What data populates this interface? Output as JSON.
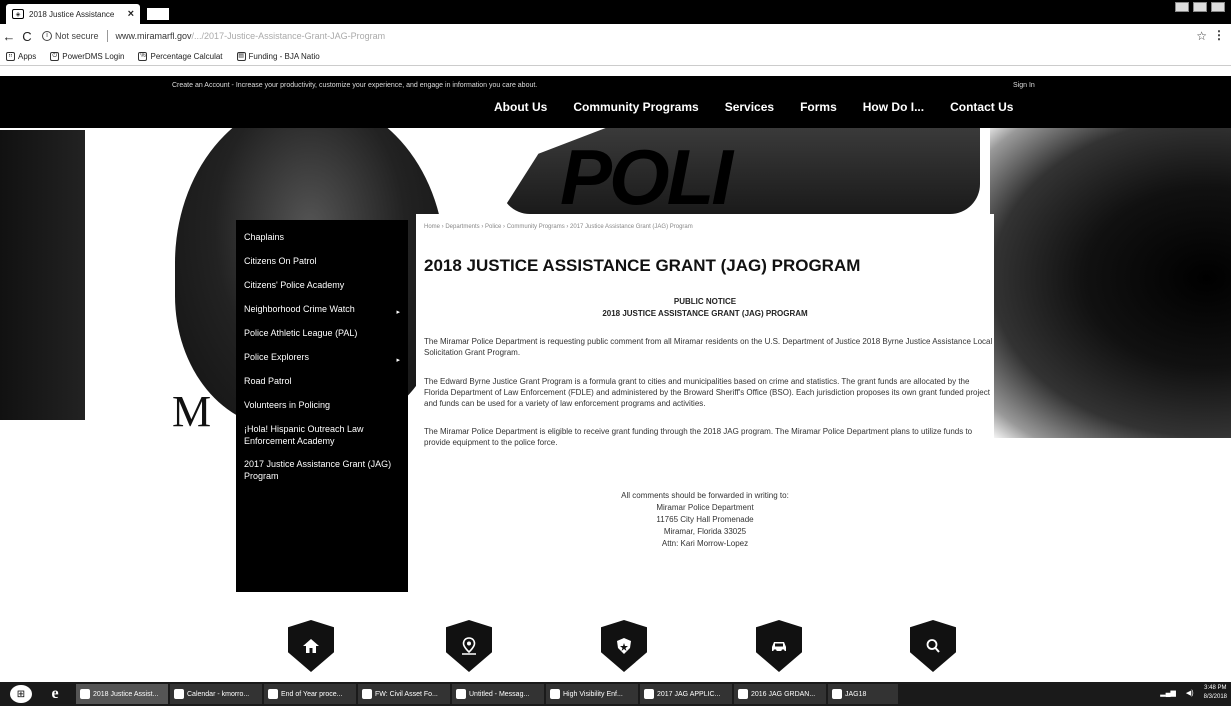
{
  "browser": {
    "tab_title": "2018 Justice Assistance",
    "tab_close": "×",
    "nav_back": "←",
    "nav_reload": "C",
    "security_label": "Not secure",
    "url": "www.miramarfl.gov",
    "url_path": "/.../2017-Justice-Assistance-Grant-JAG-Program",
    "star": "☆",
    "menu": "⋮",
    "bookmarks": [
      {
        "label": "Apps"
      },
      {
        "label": "PowerDMS Login"
      },
      {
        "label": "Percentage Calculat"
      },
      {
        "label": "Funding - BJA Natio"
      }
    ]
  },
  "site_header": {
    "promo": "Create an Account - Increase your productivity, customize your experience, and engage in information you care about.",
    "signin": "Sign In",
    "nav": [
      {
        "label": "About Us"
      },
      {
        "label": "Community Programs"
      },
      {
        "label": "Services"
      },
      {
        "label": "Forms"
      },
      {
        "label": "How Do I..."
      },
      {
        "label": "Contact Us"
      }
    ]
  },
  "hero": {
    "badge_letter": "M",
    "car_letters": "POLI"
  },
  "sidebar": {
    "items": [
      {
        "label": "Chaplains",
        "arrow": ""
      },
      {
        "label": "Citizens On Patrol",
        "arrow": ""
      },
      {
        "label": "Citizens' Police Academy",
        "arrow": ""
      },
      {
        "label": "Neighborhood Crime Watch",
        "arrow": "▸"
      },
      {
        "label": "Police Athletic League (PAL)",
        "arrow": ""
      },
      {
        "label": "Police Explorers",
        "arrow": "▸"
      },
      {
        "label": "Road Patrol",
        "arrow": ""
      },
      {
        "label": "Volunteers in Policing",
        "arrow": ""
      },
      {
        "label": "¡Hola! Hispanic Outreach Law Enforcement Academy",
        "arrow": ""
      },
      {
        "label": "2017 Justice Assistance Grant (JAG) Program",
        "arrow": ""
      }
    ]
  },
  "content": {
    "breadcrumb": "Home › Departments › Police › Community Programs › 2017 Justice Assistance Grant (JAG) Program",
    "title": "2018 JUSTICE ASSISTANCE GRANT (JAG) PROGRAM",
    "notice_line1": "PUBLIC NOTICE",
    "notice_line2": "2018 JUSTICE ASSISTANCE GRANT (JAG) PROGRAM",
    "para1": "The Miramar Police Department is requesting public comment from all Miramar residents on the U.S. Department of Justice 2018 Byrne Justice Assistance Local Solicitation Grant Program.",
    "para2": "The Edward Byrne Justice Grant Program is a formula grant to cities and municipalities based on crime and statistics. The grant funds are allocated by the Florida Department of Law Enforcement (FDLE) and administered by the Broward Sheriff's Office (BSO). Each jurisdiction proposes its own grant funded project and funds can be used for a variety of law enforcement programs and activities.",
    "para3": "The Miramar Police Department is eligible to receive grant funding through the 2018 JAG program. The Miramar Police Department plans to utilize funds to provide equipment to the police force.",
    "address": {
      "line1": "All comments should be forwarded in writing to:",
      "line2": "Miramar Police Department",
      "line3": "11765 City Hall Promenade",
      "line4": "Miramar, Florida 33025",
      "line5": "Attn: Kari Morrow-Lopez"
    }
  },
  "bottom_icons": [
    {
      "name": "home-icon"
    },
    {
      "name": "map-pin-icon"
    },
    {
      "name": "police-badge-icon"
    },
    {
      "name": "car-icon"
    },
    {
      "name": "search-icon"
    }
  ],
  "taskbar": {
    "items": [
      {
        "label": "2018 Justice Assist..."
      },
      {
        "label": "Calendar - kmorro..."
      },
      {
        "label": "End of Year proce..."
      },
      {
        "label": "FW: Civil Asset Fo..."
      },
      {
        "label": "Untitled - Messag..."
      },
      {
        "label": "High Visibility Enf..."
      },
      {
        "label": "2017 JAG APPLIC..."
      },
      {
        "label": "2016 JAG GRDAN..."
      },
      {
        "label": "JAG18"
      }
    ],
    "clock_time": "3:48 PM",
    "clock_date": "8/3/2018"
  }
}
